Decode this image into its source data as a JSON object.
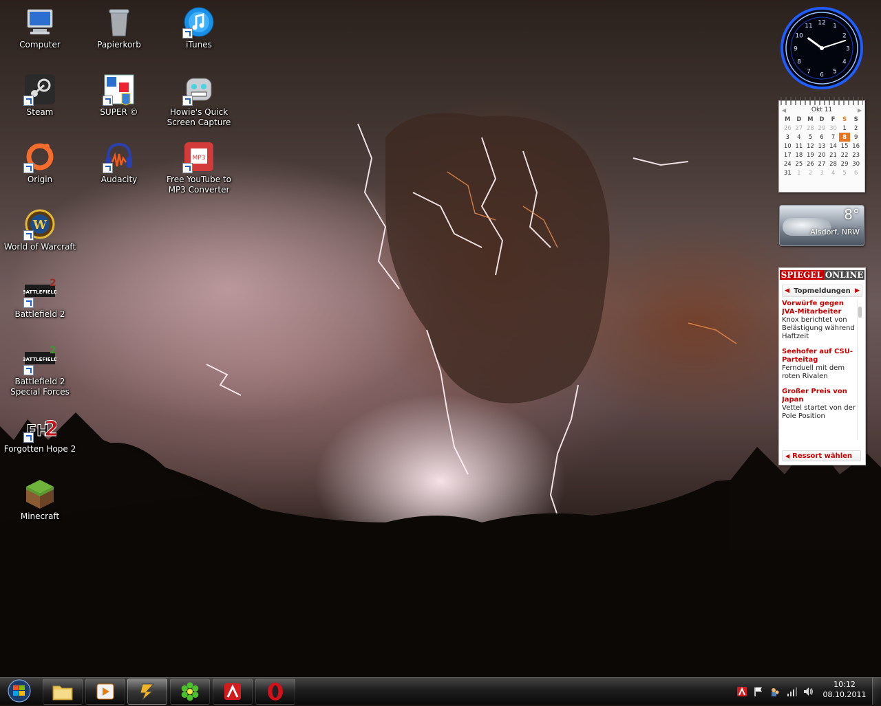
{
  "desktop": {
    "icons": [
      {
        "label": "Computer",
        "icon": "computer-icon"
      },
      {
        "label": "Papierkorb",
        "icon": "recycle-bin-icon"
      },
      {
        "label": "iTunes",
        "icon": "itunes-icon"
      },
      {
        "label": "Steam",
        "icon": "steam-icon"
      },
      {
        "label": "SUPER ©",
        "icon": "super-icon"
      },
      {
        "label": "Howie's Quick Screen Capture",
        "icon": "screen-capture-icon"
      },
      {
        "label": "Origin",
        "icon": "origin-icon"
      },
      {
        "label": "Audacity",
        "icon": "audacity-icon"
      },
      {
        "label": "Free YouTube to MP3 Converter",
        "icon": "mp3-converter-icon",
        "badge": "MP3"
      },
      {
        "label": "World of Warcraft",
        "icon": "wow-icon",
        "badge": "W"
      },
      {
        "label": "Battlefield 2",
        "icon": "battlefield2-icon",
        "badge": "BATTLEFIELD"
      },
      {
        "label": "Battlefield 2 Special Forces",
        "icon": "battlefield2-sf-icon",
        "badge": "BATTLEFIELD"
      },
      {
        "label": "Forgotten Hope 2",
        "icon": "forgotten-hope-icon",
        "badge": "FH"
      },
      {
        "label": "Minecraft",
        "icon": "minecraft-icon"
      }
    ]
  },
  "clock_gadget": {
    "numerals": [
      "12",
      "1",
      "2",
      "3",
      "4",
      "5",
      "6",
      "7",
      "8",
      "9",
      "10",
      "11"
    ],
    "hour": 10,
    "minute": 12
  },
  "calendar_gadget": {
    "month_label": "Okt 11",
    "weekdays": [
      "M",
      "D",
      "M",
      "D",
      "F",
      "S",
      "S"
    ],
    "weeks": [
      [
        "26",
        "27",
        "28",
        "29",
        "30",
        "1",
        "2"
      ],
      [
        "3",
        "4",
        "5",
        "6",
        "7",
        "8",
        "9"
      ],
      [
        "10",
        "11",
        "12",
        "13",
        "14",
        "15",
        "16"
      ],
      [
        "17",
        "18",
        "19",
        "20",
        "21",
        "22",
        "23"
      ],
      [
        "24",
        "25",
        "26",
        "27",
        "28",
        "29",
        "30"
      ],
      [
        "31",
        "1",
        "2",
        "3",
        "4",
        "5",
        "6"
      ]
    ],
    "today": "8",
    "accent_color": "#e8741e"
  },
  "weather_gadget": {
    "temperature": "8°",
    "location": "Alsdorf, NRW"
  },
  "spiegel_gadget": {
    "brand_left": "SPIEGEL",
    "brand_right": "ONLINE",
    "section": "Topmeldungen",
    "items": [
      {
        "headline": "Vorwürfe gegen JVA-Mitarbeiter",
        "teaser": "Knox berichtet von Belästigung während Haftzeit"
      },
      {
        "headline": "Seehofer auf CSU-Parteitag",
        "teaser": "Fernduell mit dem roten Rivalen"
      },
      {
        "headline": "Großer Preis von Japan",
        "teaser": "Vettel startet von der Pole Position"
      }
    ],
    "footer": "Ressort wählen",
    "accent_color": "#c80000"
  },
  "taskbar": {
    "pinned": [
      {
        "name": "explorer",
        "icon": "folder-icon"
      },
      {
        "name": "media-player",
        "icon": "media-player-icon"
      },
      {
        "name": "winamp",
        "icon": "winamp-icon"
      },
      {
        "name": "icq",
        "icon": "icq-flower-icon"
      },
      {
        "name": "avira",
        "icon": "avira-icon"
      },
      {
        "name": "opera",
        "icon": "opera-icon"
      }
    ],
    "time": "10:12",
    "date": "08.10.2011"
  }
}
